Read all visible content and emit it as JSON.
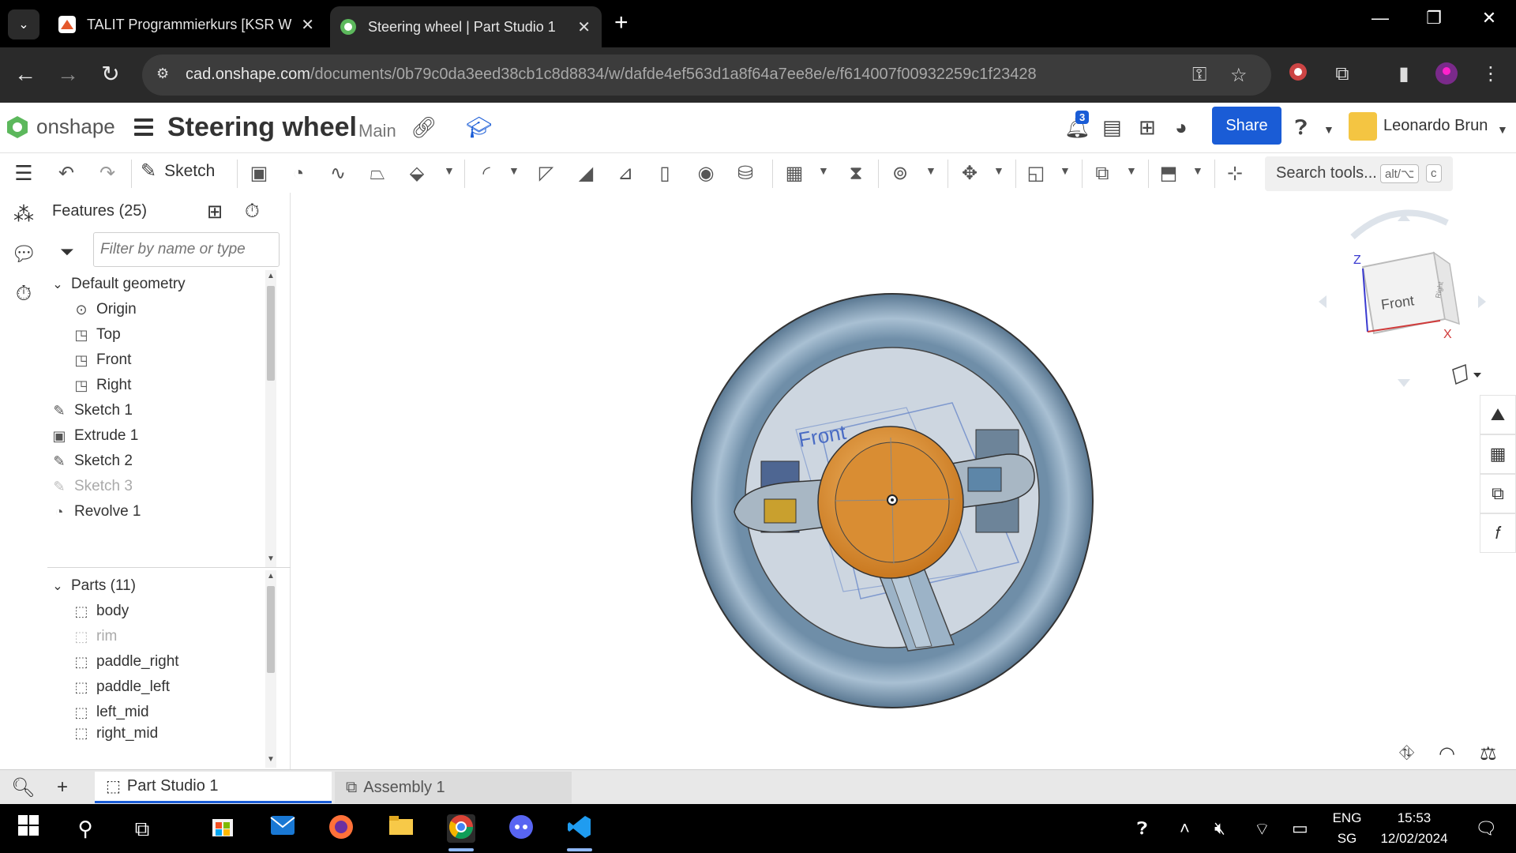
{
  "browser": {
    "tabs": [
      {
        "title": "TALIT Programmierkurs [KSR W",
        "close": "✕"
      },
      {
        "title": "Steering wheel | Part Studio 1",
        "close": "✕"
      }
    ],
    "new_tab": "+",
    "url_domain": "cad.onshape.com",
    "url_path": "/documents/0b79c0da3eed38cb1c8d8834/w/dafde4ef563d1a8f64a7ee8e/e/f614007f00932259c1f23428",
    "window_controls": {
      "minimize": "—",
      "restore": "❐",
      "close": "✕"
    }
  },
  "onshape": {
    "logo_text": "onshape",
    "doc_title": "Steering wheel",
    "branch": "Main",
    "notification_count": "3",
    "share_label": "Share",
    "user_name": "Leonardo Brun"
  },
  "toolbar": {
    "sketch_label": "Sketch",
    "search_placeholder": "Search tools...",
    "search_kbd_1": "alt/⌥",
    "search_kbd_2": "c"
  },
  "feature_panel": {
    "header": "Features (25)",
    "filter_placeholder": "Filter by name or type",
    "features": [
      {
        "label": "Default geometry",
        "type": "group"
      },
      {
        "label": "Origin",
        "type": "origin"
      },
      {
        "label": "Top",
        "type": "plane"
      },
      {
        "label": "Front",
        "type": "plane"
      },
      {
        "label": "Right",
        "type": "plane"
      },
      {
        "label": "Sketch 1",
        "type": "sketch"
      },
      {
        "label": "Extrude 1",
        "type": "extrude"
      },
      {
        "label": "Sketch 2",
        "type": "sketch"
      },
      {
        "label": "Sketch 3",
        "type": "sketch",
        "dim": true
      },
      {
        "label": "Revolve 1",
        "type": "revolve"
      }
    ],
    "parts_header": "Parts (11)",
    "parts": [
      {
        "label": "body",
        "dim": false
      },
      {
        "label": "rim",
        "dim": true
      },
      {
        "label": "paddle_right",
        "dim": false
      },
      {
        "label": "paddle_left",
        "dim": false
      },
      {
        "label": "left_mid",
        "dim": false
      },
      {
        "label": "right_mid",
        "dim": false
      }
    ]
  },
  "viewport": {
    "front_plane_label": "Front",
    "view_cube": {
      "face": "Front",
      "side": "Right",
      "axis_z": "Z",
      "axis_x": "X"
    }
  },
  "bottom_tabs": [
    {
      "label": "Part Studio 1",
      "active": true
    },
    {
      "label": "Assembly 1",
      "active": false
    }
  ],
  "taskbar": {
    "lang_1": "ENG",
    "lang_2": "SG",
    "time": "15:53",
    "date": "12/02/2024"
  },
  "colors": {
    "onshape_blue": "#1a5cd6",
    "rim_blue": "#8ea9c0",
    "hub_orange": "#e39a3a"
  }
}
